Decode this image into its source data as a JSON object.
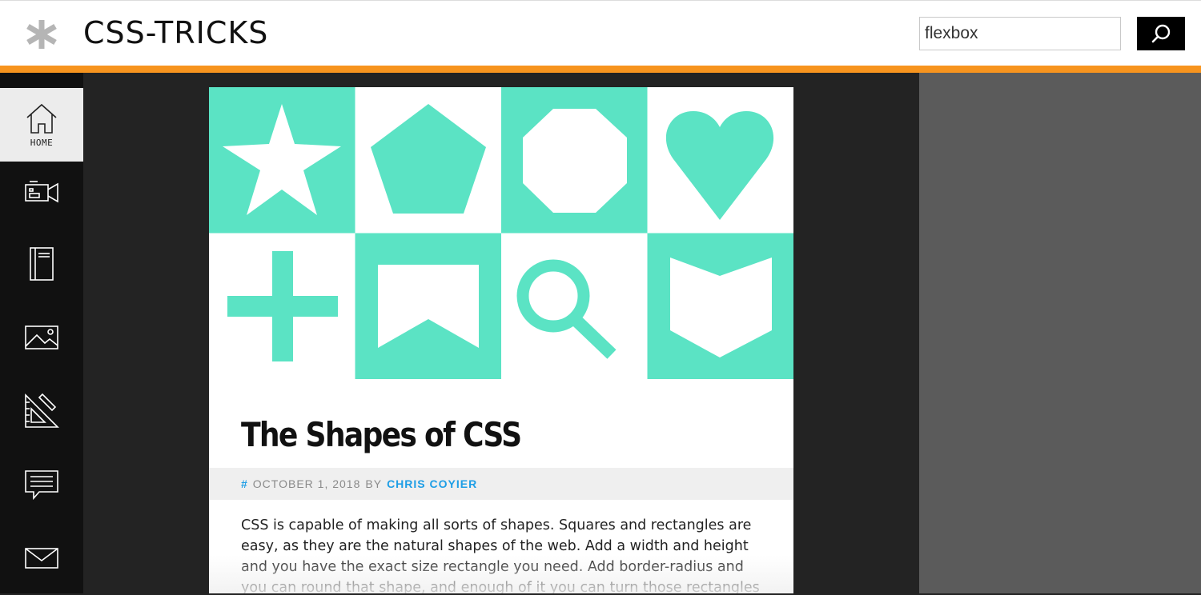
{
  "header": {
    "logo_text": "CSS-TRICKS",
    "search": {
      "value": "flexbox",
      "placeholder": ""
    },
    "colors": {
      "accent_bar": "#f7941e",
      "search_button": "#000000"
    }
  },
  "sidebar": {
    "items": [
      {
        "id": "home",
        "label": "HOME",
        "icon": "home-icon",
        "active": true
      },
      {
        "id": "videos",
        "label": "",
        "icon": "video-camera-icon",
        "active": false
      },
      {
        "id": "guides",
        "label": "",
        "icon": "book-icon",
        "active": false
      },
      {
        "id": "gallery",
        "label": "",
        "icon": "image-icon",
        "active": false
      },
      {
        "id": "design",
        "label": "",
        "icon": "ruler-triangle-icon",
        "active": false
      },
      {
        "id": "forums",
        "label": "",
        "icon": "chat-bubble-icon",
        "active": false
      },
      {
        "id": "newsletter",
        "label": "",
        "icon": "envelope-icon",
        "active": false
      }
    ]
  },
  "article": {
    "title": "The Shapes of CSS",
    "meta": {
      "hash": "#",
      "date": "OCTOBER 1, 2018",
      "by": "BY",
      "author": "CHRIS COYIER"
    },
    "excerpt": "CSS is capable of making all sorts of shapes. Squares and rectangles are easy, as they are the natural shapes of the web. Add a width and height and you have the exact size rectangle you need. Add border-radius and you can round that shape, and enough of it you can turn those rectangles",
    "hero_shapes": [
      "star-icon",
      "pentagon-icon",
      "octagon-icon",
      "heart-icon",
      "cross-icon",
      "ribbon-icon",
      "magnifier-icon",
      "shield-icon"
    ],
    "shape_color": "#5be3c4"
  }
}
